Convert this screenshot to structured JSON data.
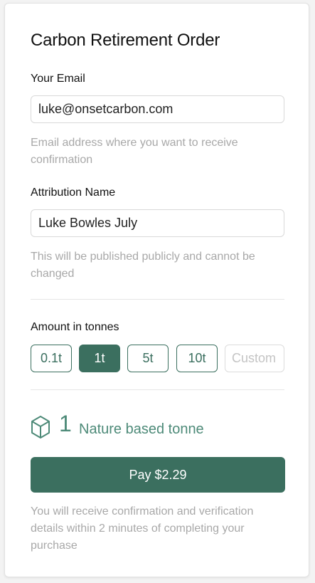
{
  "form": {
    "title": "Carbon Retirement Order",
    "email": {
      "label": "Your Email",
      "value": "luke@onsetcarbon.com",
      "hint": "Email address where you want to receive confirmation"
    },
    "attribution": {
      "label": "Attribution Name",
      "value": "Luke Bowles July",
      "hint": "This will be published publicly and cannot be changed"
    },
    "amount": {
      "label": "Amount in tonnes",
      "options": [
        "0.1t",
        "1t",
        "5t",
        "10t"
      ],
      "selected": "1t",
      "custom_placeholder": "Custom"
    },
    "summary": {
      "icon": "hexagon-cube-icon",
      "quantity": "1",
      "unit_text": "Nature based tonne"
    },
    "pay_label": "Pay $2.29",
    "footer_note": "You will receive confirmation and verification details within 2 minutes of completing your purchase"
  },
  "colors": {
    "accent": "#3b6f5f",
    "accent_text": "#4d8a78",
    "hint_text": "#a8a8a8"
  }
}
